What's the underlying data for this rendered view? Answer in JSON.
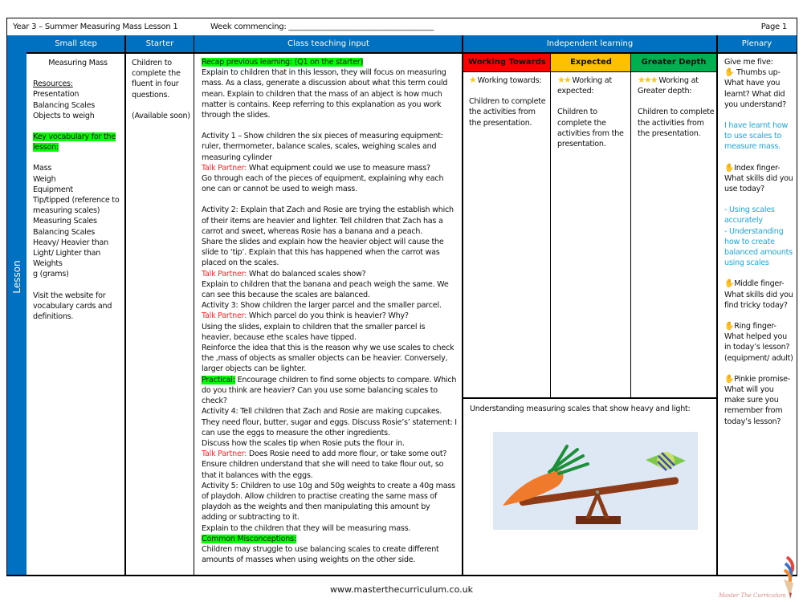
{
  "header": {
    "title": "Year 3 – Summer  Measuring Mass Lesson 1",
    "week_label": "Week commencing: ______________________________________",
    "page": "Page 1"
  },
  "columns": {
    "small_step": "Small step",
    "starter": "Starter",
    "class_teaching": "Class teaching input",
    "independent": "Independent learning",
    "plenary": "Plenary"
  },
  "lesson_label": "Lesson 1",
  "small_step": {
    "title": "Measuring Mass",
    "resources_label": "Resources:",
    "resources": [
      "Presentation",
      "Balancing Scales",
      "Objects to weigh"
    ],
    "vocab_label": "Key vocabulary for the lesson:",
    "vocab": [
      "Mass",
      "Weigh",
      "Equipment",
      "Tip/tipped (reference to measuring scales)",
      "Measuring Scales",
      "Balancing Scales",
      "Heavy/ Heavier than",
      "Light/ Lighter than",
      "Weights",
      "g (grams)"
    ],
    "website_note": "Visit the website for vocabulary cards and definitions."
  },
  "starter": {
    "text": "Children to complete the fluent in four questions.",
    "note": "(Available soon)"
  },
  "teaching": {
    "recap_label": "Recap previous learning: (Q1 on the starter)",
    "intro": "Explain to children that in this lesson, they will focus on measuring mass. As a class, generate a discussion about what this term could mean. Explain to children that the mass of an abject is how much matter is contains. Keep referring to this explanation as you work through the slides.",
    "activity1": "Activity 1 – Show children the six pieces of measuring equipment: ruler, thermometer, balance scales, scales, weighing scales and measuring cylinder",
    "talk_label": "Talk Partner:",
    "talk1": " What equipment could we use to measure mass?",
    "act1_after": "Go through each of the pieces of equipment, explaining why each one can or cannot be used to weigh mass.",
    "activity2": "Activity 2: Explain that Zach and Rosie are trying the establish which of their items are heavier and lighter. Tell children that Zach has a carrot and sweet, whereas Rosie has a banana and a peach.",
    "act2_b": "Share the slides and explain how the heavier object will cause the slide to ‘tip’. Explain that this has happened when the carrot was placed on the scales.",
    "talk2": " What do balanced scales show?",
    "act2_c": "Explain to children that the banana and peach weigh the same. We can see this because the scales are balanced.",
    "activity3": "Activity 3: Show children the larger parcel and the smaller parcel.",
    "talk3": " Which parcel do you think is heavier? Why?",
    "act3_b": "Using the slides, explain to children that the smaller parcel is heavier, because ethe scales have tipped.",
    "act3_c": "Reinforce the idea that this is the reason why we use scales to check the ,mass of objects as smaller objects can be heavier. Conversely, larger objects can be lighter.",
    "practical_label": "Practical:",
    "practical": " Encourage children to find some objects to compare. Which do you think are heavier? Can you use some balancing scales to check?",
    "activity4": "Activity 4: Tell children that Zach and Rosie are making cupcakes. They need flour, butter, sugar and eggs. Discuss Rosie’s’ statement: I can use the eggs to measure the other ingredients.",
    "act4_b": "Discuss how the scales tip when Rosie puts the flour in.",
    "talk4": " Does Rosie need to add more flour, or take some out?",
    "act4_c": "Ensure children understand that she will need to take flour out, so that it balances with the eggs.",
    "activity5": "Activity 5: Children to use 10g and 50g weights to create a 40g mass of playdoh. Allow children to practise creating the same mass of playdoh as the weights and then manipulating this amount by adding or subtracting to it.",
    "act5_b": "Explain to the children that they will be measuring mass.",
    "misconceptions_label": "Common Misconceptions:",
    "misconceptions": "Children may struggle to use balancing scales to create different amounts of masses when using weights on the other side."
  },
  "independent": {
    "levels": [
      {
        "label": "Working Towards",
        "color": "#ff0000",
        "stars": "★",
        "heading": " Working towards:",
        "text": "Children to complete the activities from the presentation."
      },
      {
        "label": "Expected",
        "color": "#ffc000",
        "stars": "★★",
        "heading": " Working at expected:",
        "text": "Children to complete the activities from the presentation."
      },
      {
        "label": "Greater Depth",
        "color": "#00b050",
        "stars": "★★★",
        "heading": " Working at Greater depth:",
        "text": "Children to complete the activities from the presentation."
      }
    ],
    "image_caption": "Understanding measuring scales that show heavy and light:"
  },
  "plenary": {
    "intro": "Give me five:",
    "thumbs": "Thumbs up- What have you learnt? What did you understand?",
    "thumbs_answer": "I have learnt how to use scales to measure mass.",
    "index": "Index finger- What skills did you use today?",
    "index_answer": "- Using scales accurately\n- Understanding how to create balanced amounts using scales",
    "middle": "Middle finger- What skills did you find tricky today?",
    "ring": "Ring finger- What helped you in today’s lesson? (equipment/ adult)",
    "pinkie": "Pinkie promise- What will you make sure you remember from today’s lesson?"
  },
  "footer": {
    "url": "www.masterthecurriculum.co.uk",
    "logo_text": "Master The Curriculum"
  },
  "colors": {
    "header_blue": "#0070c0",
    "highlight_green": "#00ff00",
    "talk_red": "#ff2b2b",
    "answer_cyan": "#1fa8e0"
  }
}
